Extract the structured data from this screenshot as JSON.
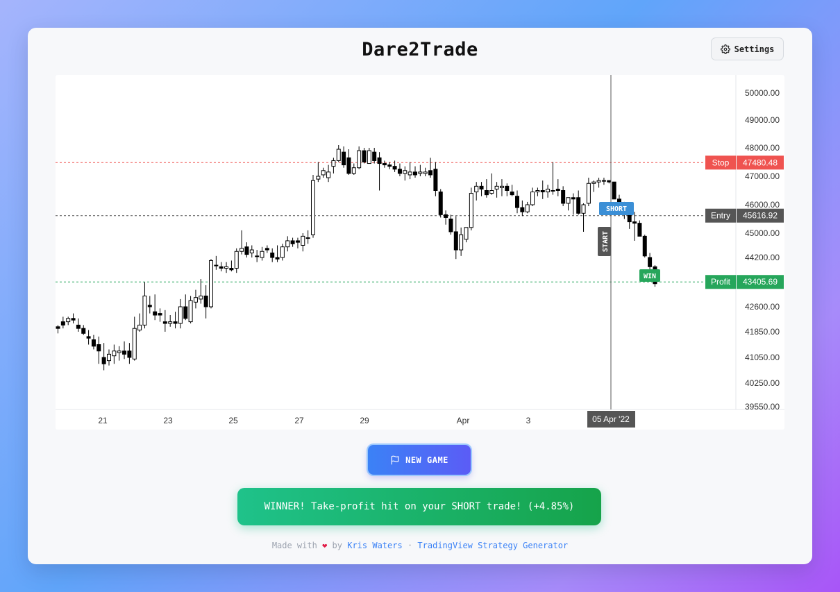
{
  "app": {
    "title": "Dare2Trade",
    "settings_label": "Settings",
    "new_game_label": "NEW GAME",
    "result_message": "WINNER! Take-profit hit on your SHORT trade! (+4.85%)"
  },
  "footer": {
    "made_with": "Made with",
    "by": "by",
    "author": "Kris Waters",
    "separator": "·",
    "generator_link": "TradingView Strategy Generator",
    "heart_icon": "heart-icon"
  },
  "colors": {
    "stop": "#ef5350",
    "entry": "#555555",
    "profit": "#26a65b",
    "short_badge": "#3b8fd6",
    "win_badge": "#26a65b",
    "start_badge": "#555555"
  },
  "chart_data": {
    "type": "candlestick",
    "y_ticks": [
      "50000.00",
      "49000.00",
      "48000.00",
      "47000.00",
      "46000.00",
      "45000.00",
      "44200.00",
      "42600.00",
      "41850.00",
      "41050.00",
      "40250.00",
      "39550.00"
    ],
    "x_ticks": [
      "21",
      "23",
      "25",
      "27",
      "29",
      "Apr",
      "3"
    ],
    "crosshair_label": "05 Apr '22",
    "levels": [
      {
        "name": "Stop",
        "value": 47480.48,
        "label": "47480.48"
      },
      {
        "name": "Entry",
        "value": 45616.92,
        "label": "45616.92"
      },
      {
        "name": "Profit",
        "value": 43405.69,
        "label": "43405.69"
      }
    ],
    "markers": {
      "short": "SHORT",
      "start": "START",
      "win": "WIN"
    },
    "candles": [
      [
        42000,
        42050,
        41800,
        41950
      ],
      [
        42150,
        42300,
        41950,
        42050
      ],
      [
        42150,
        42300,
        42050,
        42250
      ],
      [
        42250,
        42400,
        42100,
        42200
      ],
      [
        42050,
        42250,
        41850,
        41950
      ],
      [
        41950,
        42050,
        41750,
        41800
      ],
      [
        41700,
        41900,
        41450,
        41650
      ],
      [
        41600,
        41750,
        41300,
        41400
      ],
      [
        41450,
        41700,
        40850,
        41250
      ],
      [
        41050,
        41500,
        40650,
        40850
      ],
      [
        40950,
        41300,
        40800,
        41150
      ],
      [
        41100,
        41450,
        40850,
        41250
      ],
      [
        41200,
        41400,
        40950,
        41250
      ],
      [
        41250,
        41550,
        41000,
        41150
      ],
      [
        41250,
        41500,
        40850,
        41050
      ],
      [
        41000,
        42300,
        40950,
        41950
      ],
      [
        41900,
        42400,
        41850,
        42050
      ],
      [
        42050,
        43400,
        41950,
        42950
      ],
      [
        42650,
        42950,
        42400,
        42600
      ],
      [
        42450,
        43000,
        42200,
        42350
      ],
      [
        42400,
        42550,
        42150,
        42350
      ],
      [
        42150,
        42500,
        41850,
        42100
      ],
      [
        42100,
        42350,
        42000,
        42150
      ],
      [
        42150,
        42450,
        41950,
        42100
      ],
      [
        42100,
        42850,
        41950,
        42600
      ],
      [
        42600,
        43000,
        42200,
        42250
      ],
      [
        42150,
        42950,
        42100,
        42800
      ],
      [
        42750,
        43150,
        42550,
        42900
      ],
      [
        42850,
        43500,
        42700,
        42950
      ],
      [
        42950,
        43300,
        42250,
        42600
      ],
      [
        42600,
        44150,
        42550,
        44100
      ],
      [
        43950,
        44250,
        43800,
        43950
      ],
      [
        43900,
        44050,
        43750,
        43850
      ],
      [
        43850,
        44050,
        43700,
        43900
      ],
      [
        43850,
        44100,
        43750,
        43800
      ],
      [
        43850,
        44500,
        43700,
        44400
      ],
      [
        44400,
        45100,
        44300,
        44500
      ],
      [
        44550,
        44700,
        44200,
        44300
      ],
      [
        44350,
        44600,
        44200,
        44450
      ],
      [
        44250,
        44450,
        44050,
        44250
      ],
      [
        44200,
        44550,
        44100,
        44400
      ],
      [
        44500,
        44600,
        44350,
        44450
      ],
      [
        44350,
        44500,
        44050,
        44200
      ],
      [
        44200,
        44600,
        44050,
        44150
      ],
      [
        44200,
        44650,
        44100,
        44550
      ],
      [
        44550,
        44900,
        44400,
        44750
      ],
      [
        44750,
        44850,
        44550,
        44650
      ],
      [
        44750,
        44850,
        44500,
        44700
      ],
      [
        44600,
        45000,
        44400,
        44900
      ],
      [
        44850,
        45100,
        44650,
        44850
      ],
      [
        44950,
        47050,
        44850,
        46850
      ],
      [
        46900,
        47500,
        46800,
        47000
      ],
      [
        47050,
        47300,
        46950,
        47200
      ],
      [
        46950,
        47400,
        46800,
        47150
      ],
      [
        47350,
        47650,
        47100,
        47550
      ],
      [
        47550,
        48100,
        47500,
        47950
      ],
      [
        47850,
        48050,
        47300,
        47400
      ],
      [
        47650,
        47950,
        47050,
        47100
      ],
      [
        47100,
        47450,
        47050,
        47300
      ],
      [
        47300,
        48050,
        47250,
        47900
      ],
      [
        47900,
        48000,
        47450,
        47500
      ],
      [
        47450,
        48000,
        47450,
        47900
      ],
      [
        47850,
        48000,
        47450,
        47550
      ],
      [
        47650,
        47850,
        46500,
        47450
      ],
      [
        47450,
        47550,
        47300,
        47400
      ],
      [
        47400,
        47500,
        47250,
        47350
      ],
      [
        47350,
        47550,
        47150,
        47250
      ],
      [
        47250,
        47450,
        47000,
        47100
      ],
      [
        47100,
        47350,
        46850,
        47200
      ],
      [
        47050,
        47500,
        46900,
        47150
      ],
      [
        47150,
        47350,
        46950,
        47050
      ],
      [
        47100,
        47400,
        47000,
        47150
      ],
      [
        47100,
        47300,
        47000,
        47150
      ],
      [
        47200,
        47650,
        46950,
        47050
      ],
      [
        47250,
        47500,
        46300,
        46500
      ],
      [
        46450,
        46550,
        45550,
        45650
      ],
      [
        45650,
        45800,
        45300,
        45550
      ],
      [
        45500,
        45650,
        44950,
        45050
      ],
      [
        45050,
        45600,
        44150,
        44450
      ],
      [
        44450,
        45200,
        44250,
        44950
      ],
      [
        44800,
        45200,
        44700,
        45200
      ],
      [
        45200,
        46600,
        45100,
        46400
      ],
      [
        46450,
        46800,
        46150,
        46650
      ],
      [
        46650,
        46800,
        46300,
        46550
      ],
      [
        46500,
        46900,
        46250,
        46350
      ],
      [
        46400,
        47100,
        46350,
        46500
      ],
      [
        46550,
        46800,
        46250,
        46650
      ],
      [
        46600,
        46900,
        46300,
        46650
      ],
      [
        46650,
        46750,
        46300,
        46500
      ],
      [
        46450,
        46700,
        46300,
        46350
      ],
      [
        46300,
        46500,
        45700,
        45900
      ],
      [
        45900,
        46150,
        45600,
        45750
      ],
      [
        45750,
        46100,
        45700,
        46000
      ],
      [
        46000,
        46600,
        45950,
        46450
      ],
      [
        46450,
        46600,
        46300,
        46500
      ],
      [
        46500,
        46850,
        46200,
        46450
      ],
      [
        46450,
        46700,
        46250,
        46550
      ],
      [
        46500,
        47500,
        46350,
        46500
      ],
      [
        46550,
        46900,
        46300,
        46500
      ],
      [
        46500,
        46650,
        45950,
        46050
      ],
      [
        46050,
        46250,
        45800,
        46250
      ],
      [
        46250,
        46400,
        45650,
        46200
      ],
      [
        46250,
        46500,
        45650,
        45700
      ],
      [
        45700,
        46050,
        45050,
        46000
      ],
      [
        46050,
        46950,
        45950,
        46750
      ],
      [
        46750,
        46850,
        46450,
        46800
      ],
      [
        46800,
        46950,
        46600,
        46850
      ],
      [
        46850,
        46950,
        46700,
        46850
      ],
      [
        46850,
        46850,
        46750,
        46800
      ],
      [
        46800,
        46800,
        46200,
        46200
      ],
      [
        46200,
        46350,
        45850,
        46050
      ],
      [
        46000,
        46100,
        45500,
        45650
      ],
      [
        45650,
        45800,
        45150,
        45400
      ],
      [
        45400,
        45750,
        44750,
        45350
      ],
      [
        45350,
        45450,
        44900,
        44900
      ],
      [
        44900,
        44950,
        44200,
        44250
      ],
      [
        44200,
        44350,
        43700,
        43900
      ],
      [
        43900,
        43950,
        43250,
        43350
      ]
    ]
  }
}
